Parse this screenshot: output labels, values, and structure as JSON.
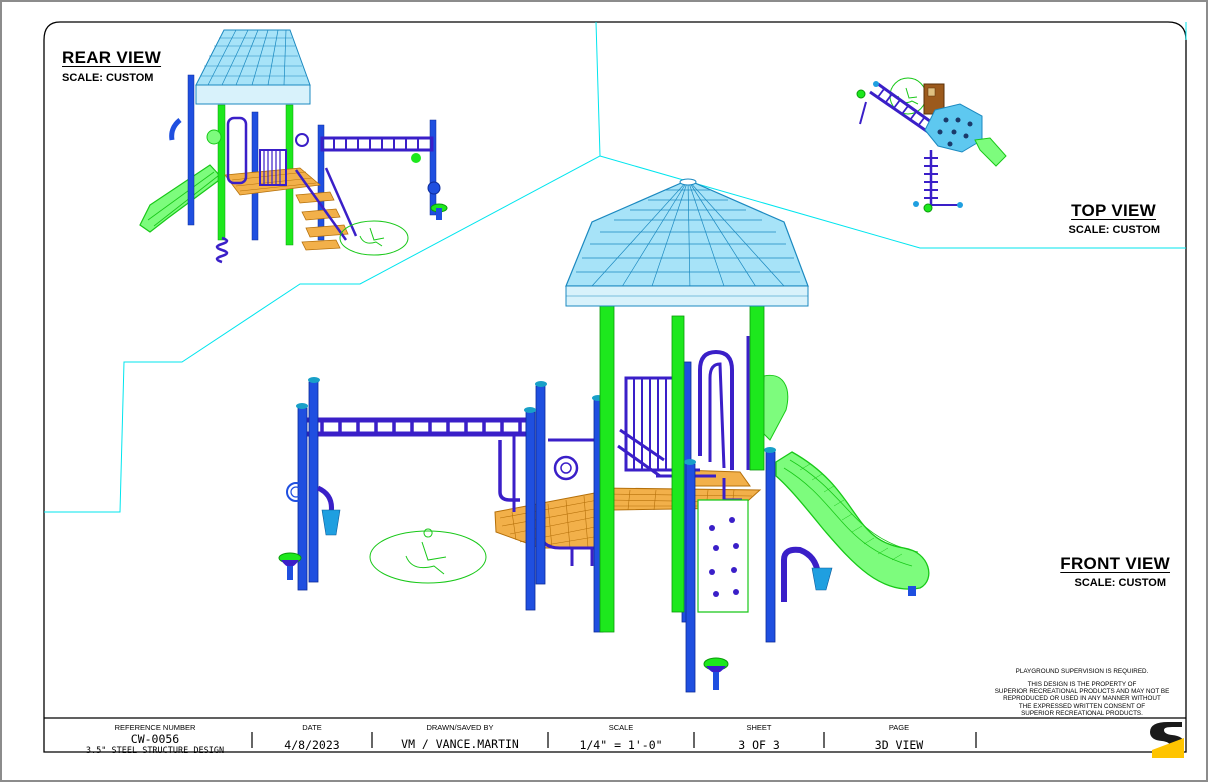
{
  "views": {
    "rear": {
      "title": "REAR VIEW",
      "scale": "SCALE: CUSTOM"
    },
    "top": {
      "title": "TOP VIEW",
      "scale": "SCALE: CUSTOM"
    },
    "front": {
      "title": "FRONT VIEW",
      "scale": "SCALE: CUSTOM"
    }
  },
  "notes": {
    "supervision": "PLAYGROUND SUPERVISION IS REQUIRED.",
    "property_lines": [
      "THIS DESIGN IS THE PROPERTY OF",
      "SUPERIOR RECREATIONAL PRODUCTS AND MAY NOT BE",
      "REPRODUCED OR USED IN ANY MANNER WITHOUT",
      "THE EXPRESSED WRITTEN CONSENT OF",
      "SUPERIOR RECREATIONAL PRODUCTS."
    ]
  },
  "title_block": {
    "reference_label": "REFERENCE NUMBER",
    "reference_value": "CW-0056",
    "reference_sub": "3.5\" STEEL STRUCTURE DESIGN",
    "date_label": "DATE",
    "date_value": "4/8/2023",
    "drawn_label": "DRAWN/SAVED BY",
    "drawn_value": "VM / VANCE.MARTIN",
    "scale_label": "SCALE",
    "scale_value": "1/4\" = 1'-0\"",
    "sheet_label": "SHEET",
    "sheet_value": "3 OF 3",
    "page_label": "PAGE",
    "page_value": "3D_VIEW"
  },
  "logo_letter": "S",
  "colors": {
    "frame_line": "#000000",
    "guide_line": "#00e5ee",
    "post_blue": "#1f4fe0",
    "post_green": "#1de81d",
    "purple": "#3a1fc8",
    "roof": "#5ec8f0",
    "deck": "#e0a030",
    "logo_yellow": "#ffc400"
  }
}
